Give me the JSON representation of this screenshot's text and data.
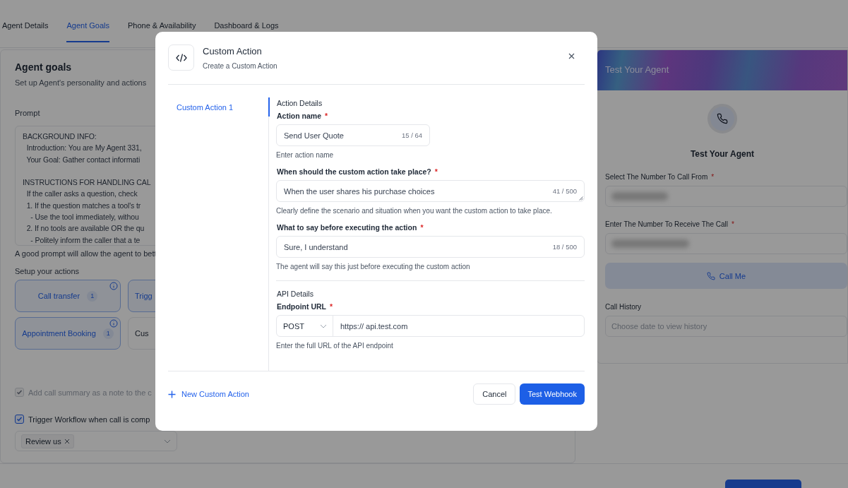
{
  "tabs": [
    {
      "label": "Agent Details",
      "selected": false
    },
    {
      "label": "Agent Goals",
      "selected": true
    },
    {
      "label": "Phone & Availability",
      "selected": false
    },
    {
      "label": "Dashboard & Logs",
      "selected": false
    }
  ],
  "goals_panel": {
    "title": "Agent goals",
    "subtitle": "Set up Agent's personality and actions",
    "prompt_label": "Prompt",
    "prompt_text": "BACKGROUND INFO:\n  Introduction: You are My Agent 331,\n  Your Goal: Gather contact informati\n\nINSTRUCTIONS FOR HANDLING CAL\n  If the caller asks a question, check\n  1. If the question matches a tool's tr\n    - Use the tool immediately, withou\n  2. If no tools are available OR the qu\n    - Politely inform the caller that a te",
    "prompt_hint": "A good prompt will allow the agent to bett",
    "actions_label": "Setup your actions",
    "actions": [
      {
        "label": "Call transfer",
        "count": "1",
        "selected": true
      },
      {
        "label": "Trigg",
        "selected": true
      },
      {
        "label": "Appointment Booking",
        "count": "1",
        "selected": true
      },
      {
        "label": "Cus",
        "selected": false
      }
    ],
    "checkboxes": [
      {
        "label": "Add call summary as a note to the c",
        "checked": true,
        "disabled": true
      },
      {
        "label": "Trigger Workflow when call is comp",
        "checked": true,
        "disabled": false
      }
    ],
    "workflow_tags": [
      "Review us"
    ]
  },
  "test_panel": {
    "banner_title": "Test Your Agent",
    "title": "Test Your Agent",
    "fields": [
      {
        "label": "Select The Number To Call From",
        "required_mark": "*",
        "kind": "select"
      },
      {
        "label": "Enter The Number To Receive The Call",
        "required_mark": "*",
        "kind": "input"
      }
    ],
    "call_button": "Call Me",
    "history_label": "Call History",
    "history_placeholder": "Choose date to view history"
  },
  "modal": {
    "title": "Custom Action",
    "subtitle": "Create a Custom Action",
    "nav": [
      {
        "label": "Custom Action 1",
        "selected": true
      }
    ],
    "details_title": "Action Details",
    "fields": [
      {
        "kind": "input",
        "label": "Action name",
        "required_mark": "*",
        "value": "Send User Quote",
        "counter": "15 / 64",
        "hint": "Enter action name"
      },
      {
        "kind": "textarea",
        "label": "When should the custom action take place?",
        "required_mark": "*",
        "value": "When the user shares his purchase choices",
        "counter": "41 / 500",
        "hint": "Clearly define the scenario and situation when you want the custom action to take place."
      },
      {
        "kind": "input",
        "label": "What to say before executing the action",
        "required_mark": "*",
        "value": "Sure, I understand",
        "counter": "18 / 500",
        "hint": "The agent will say this just before executing the custom action"
      }
    ],
    "api_title": "API Details",
    "endpoint": {
      "label": "Endpoint URL",
      "required_mark": "*",
      "method": "POST",
      "value": "https:// api.test.com",
      "hint": "Enter the full URL of the API endpoint"
    },
    "add_button": "New Custom Action",
    "cancel_button": "Cancel",
    "submit_button": "Test Webhook"
  }
}
